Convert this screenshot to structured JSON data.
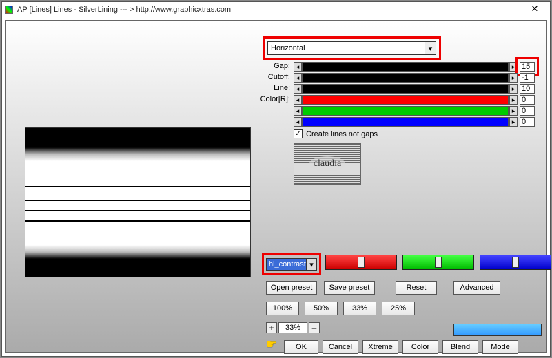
{
  "title": "AP [Lines]  Lines - SilverLining    --- > http://www.graphicxtras.com",
  "close_x": "✕",
  "orientation": {
    "selected": "Horizontal"
  },
  "params": {
    "gap": {
      "label": "Gap:",
      "value": "15"
    },
    "cutoff": {
      "label": "Cutoff:",
      "value": "-1"
    },
    "line": {
      "label": "Line:",
      "value": "10"
    },
    "colorR": {
      "label": "Color[R]:",
      "value": "0"
    },
    "colorG": {
      "label": "",
      "value": "0"
    },
    "colorB": {
      "label": "",
      "value": "0"
    }
  },
  "checkbox": {
    "label": "Create lines not gaps",
    "checked": "✓"
  },
  "claudia": "claudia",
  "preset": {
    "selected": "hi_contrast"
  },
  "buttons": {
    "open_preset": "Open preset",
    "save_preset": "Save preset",
    "reset": "Reset",
    "advanced": "Advanced",
    "p100": "100%",
    "p50": "50%",
    "p33": "33%",
    "p25": "25%",
    "zoom_minus": "–",
    "zoom_plus": "+",
    "zoom_value": "33%",
    "ok": "OK",
    "cancel": "Cancel",
    "xtreme": "Xtreme",
    "color": "Color",
    "blend": "Blend",
    "mode": "Mode"
  },
  "hand_cursor": "☛"
}
